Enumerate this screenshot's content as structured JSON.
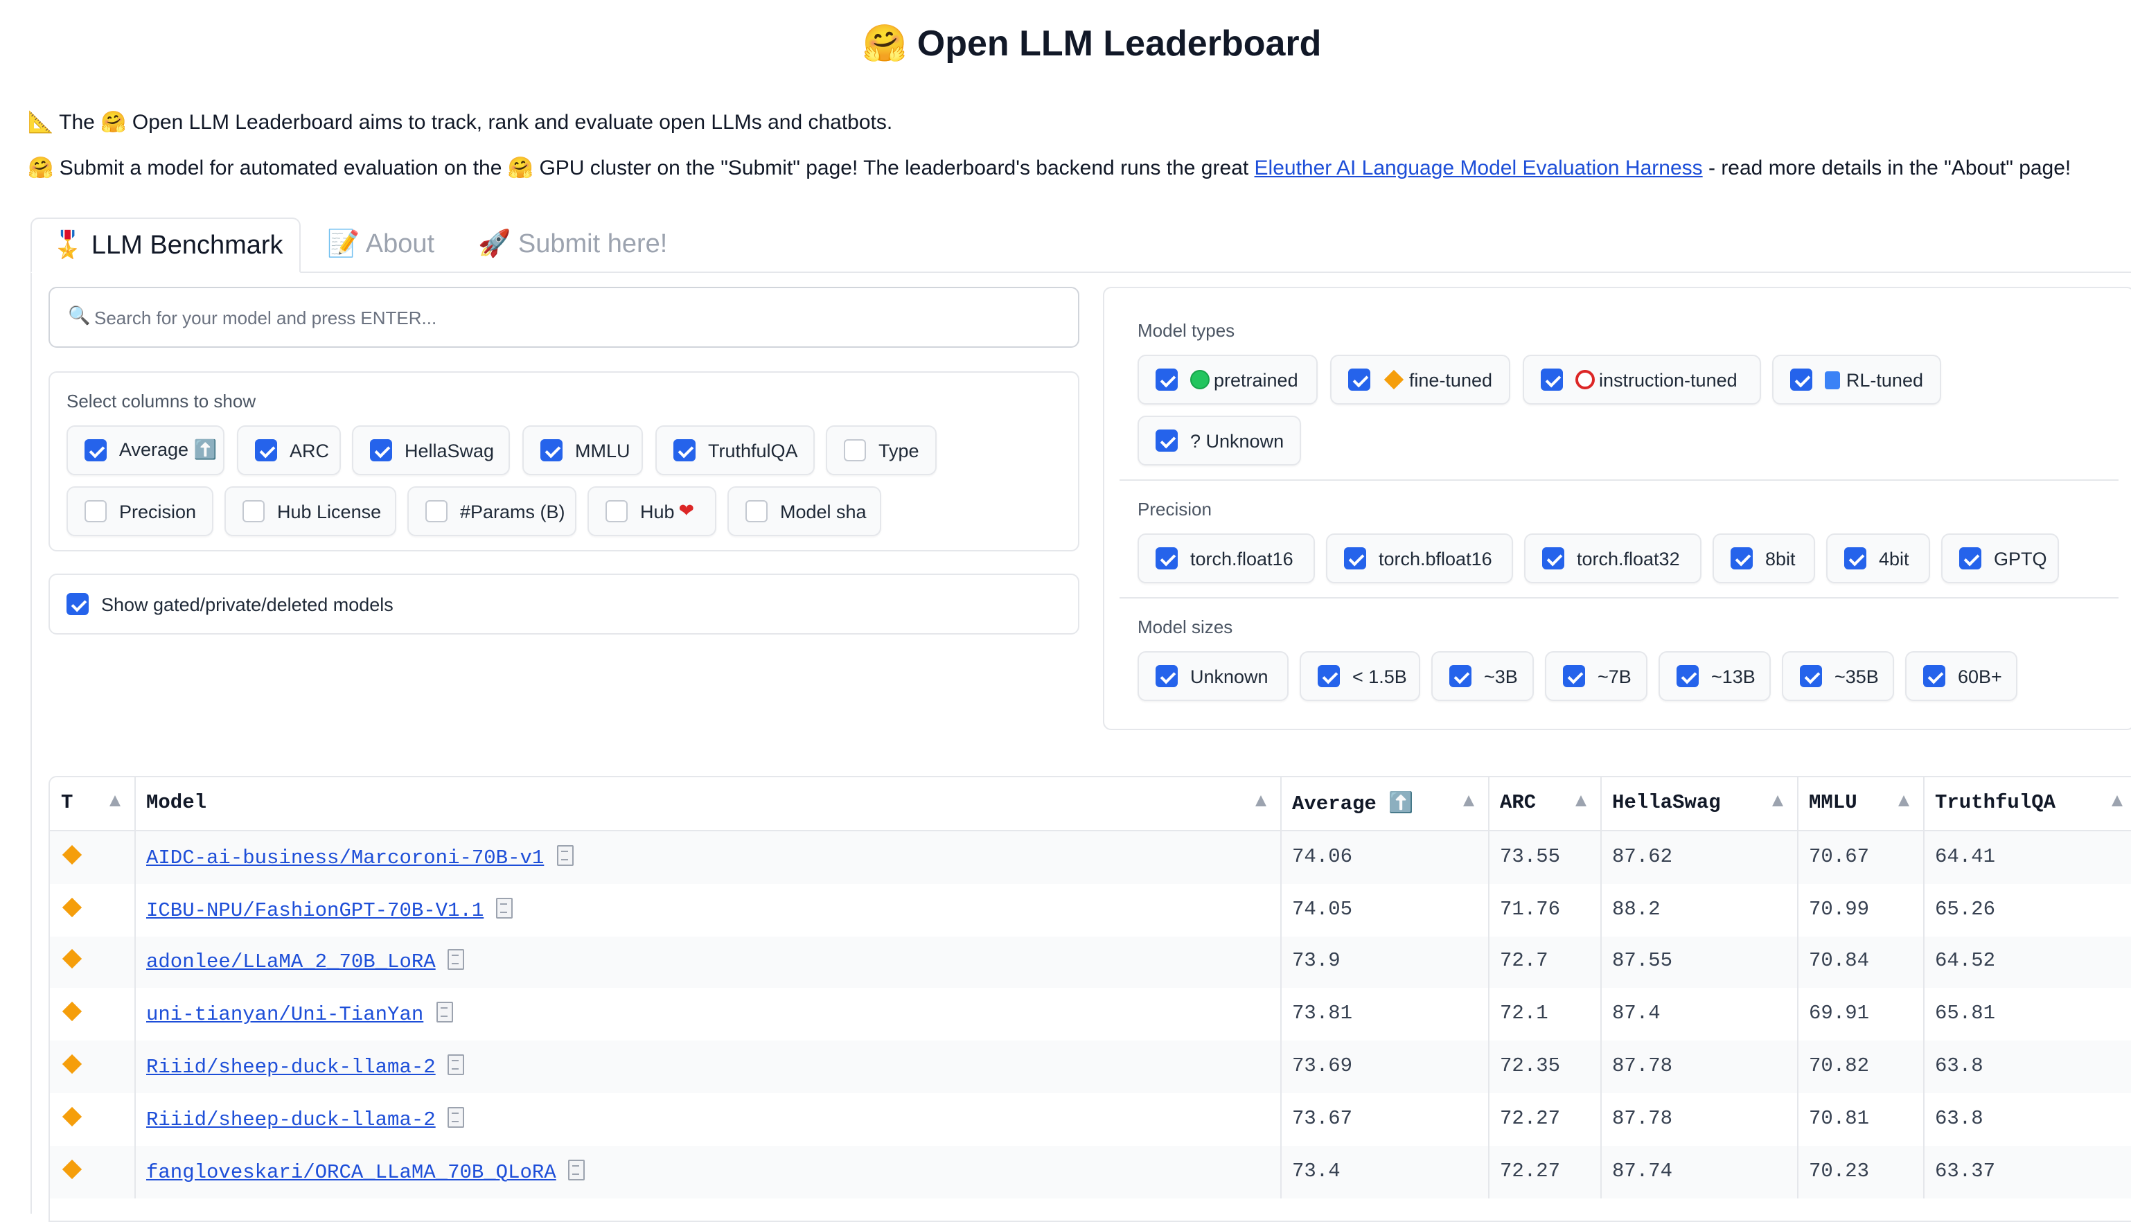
{
  "header": {
    "title": "🤗 Open LLM Leaderboard",
    "intro_line1": "📐 The 🤗 Open LLM Leaderboard aims to track, rank and evaluate open LLMs and chatbots.",
    "intro_line2_prefix": "🤗 Submit a model for automated evaluation on the 🤗 GPU cluster on the \"Submit\" page! The leaderboard's backend runs the great ",
    "intro_line2_link": "Eleuther AI Language Model Evaluation Harness",
    "intro_line2_suffix": " - read more details in the \"About\" page!"
  },
  "tabs": [
    {
      "label": "🎖️ LLM Benchmark",
      "active": true
    },
    {
      "label": "📝 About",
      "active": false
    },
    {
      "label": "🚀 Submit here!",
      "active": false
    }
  ],
  "search": {
    "placeholder": "Search for your model and press ENTER...",
    "icon": "magnifier-icon"
  },
  "columns_panel": {
    "label": "Select columns to show",
    "options": [
      {
        "label": "Average ⬆️",
        "checked": true
      },
      {
        "label": "ARC",
        "checked": true
      },
      {
        "label": "HellaSwag",
        "checked": true
      },
      {
        "label": "MMLU",
        "checked": true
      },
      {
        "label": "TruthfulQA",
        "checked": true
      },
      {
        "label": "Type",
        "checked": false
      },
      {
        "label": "Precision",
        "checked": false
      },
      {
        "label": "Hub License",
        "checked": false
      },
      {
        "label": "#Params (B)",
        "checked": false
      },
      {
        "label": "Hub",
        "checked": false
      },
      {
        "label": "Model sha",
        "checked": false
      }
    ]
  },
  "gated": {
    "label": "Show gated/private/deleted models",
    "checked": true
  },
  "model_types": {
    "label": "Model types",
    "options": [
      {
        "label": "pretrained",
        "icon": "green-circle-icon",
        "checked": true
      },
      {
        "label": "fine-tuned",
        "icon": "orange-diamond-icon",
        "checked": true
      },
      {
        "label": "instruction-tuned",
        "icon": "red-ring-icon",
        "checked": true
      },
      {
        "label": "RL-tuned",
        "icon": "blue-square-icon",
        "checked": true
      },
      {
        "label": "? Unknown",
        "icon": "",
        "checked": true
      }
    ]
  },
  "precision": {
    "label": "Precision",
    "options": [
      {
        "label": "torch.float16",
        "checked": true
      },
      {
        "label": "torch.bfloat16",
        "checked": true
      },
      {
        "label": "torch.float32",
        "checked": true
      },
      {
        "label": "8bit",
        "checked": true
      },
      {
        "label": "4bit",
        "checked": true
      },
      {
        "label": "GPTQ",
        "checked": true
      }
    ]
  },
  "model_sizes": {
    "label": "Model sizes",
    "options": [
      {
        "label": "Unknown",
        "checked": true
      },
      {
        "label": "< 1.5B",
        "checked": true
      },
      {
        "label": "~3B",
        "checked": true
      },
      {
        "label": "~7B",
        "checked": true
      },
      {
        "label": "~13B",
        "checked": true
      },
      {
        "label": "~35B",
        "checked": true
      },
      {
        "label": "60B+",
        "checked": true
      }
    ]
  },
  "table": {
    "headers": [
      "T",
      "Model",
      "Average ⬆️",
      "ARC",
      "HellaSwag",
      "MMLU",
      "TruthfulQA"
    ],
    "rows": [
      {
        "type_icon": "orange-diamond-icon",
        "model": "AIDC-ai-business/Marcoroni-70B-v1",
        "average": "74.06",
        "arc": "73.55",
        "hellaswag": "87.62",
        "mmlu": "70.67",
        "truthfulqa": "64.41"
      },
      {
        "type_icon": "orange-diamond-icon",
        "model": "ICBU-NPU/FashionGPT-70B-V1.1",
        "average": "74.05",
        "arc": "71.76",
        "hellaswag": "88.2",
        "mmlu": "70.99",
        "truthfulqa": "65.26"
      },
      {
        "type_icon": "orange-diamond-icon",
        "model": "adonlee/LLaMA_2_70B_LoRA",
        "average": "73.9",
        "arc": "72.7",
        "hellaswag": "87.55",
        "mmlu": "70.84",
        "truthfulqa": "64.52"
      },
      {
        "type_icon": "orange-diamond-icon",
        "model": "uni-tianyan/Uni-TianYan",
        "average": "73.81",
        "arc": "72.1",
        "hellaswag": "87.4",
        "mmlu": "69.91",
        "truthfulqa": "65.81"
      },
      {
        "type_icon": "orange-diamond-icon",
        "model": "Riiid/sheep-duck-llama-2",
        "average": "73.69",
        "arc": "72.35",
        "hellaswag": "87.78",
        "mmlu": "70.82",
        "truthfulqa": "63.8"
      },
      {
        "type_icon": "orange-diamond-icon",
        "model": "Riiid/sheep-duck-llama-2",
        "average": "73.67",
        "arc": "72.27",
        "hellaswag": "87.78",
        "mmlu": "70.81",
        "truthfulqa": "63.8"
      },
      {
        "type_icon": "orange-diamond-icon",
        "model": "fangloveskari/ORCA_LLaMA_70B_QLoRA",
        "average": "73.4",
        "arc": "72.27",
        "hellaswag": "87.74",
        "mmlu": "70.23",
        "truthfulqa": "63.37"
      }
    ]
  }
}
